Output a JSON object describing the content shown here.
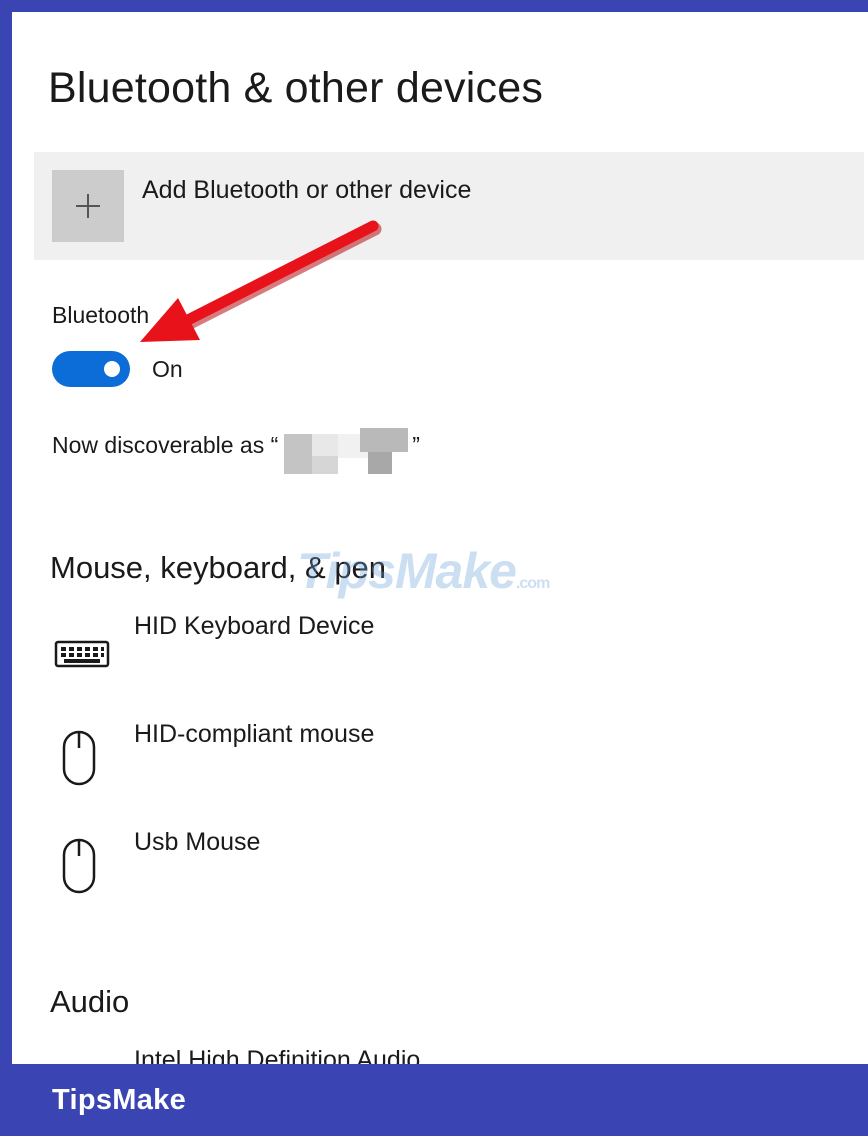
{
  "page": {
    "title": "Bluetooth & other devices"
  },
  "add_device": {
    "label": "Add Bluetooth or other device",
    "icon": "plus-icon"
  },
  "bluetooth": {
    "label": "Bluetooth",
    "toggle_on": true,
    "state_label": "On",
    "discoverable_prefix": "Now discoverable as “",
    "discoverable_suffix": "”"
  },
  "groups": {
    "input": {
      "heading": "Mouse, keyboard, & pen",
      "devices": [
        {
          "name": "HID Keyboard Device",
          "icon": "keyboard-icon"
        },
        {
          "name": "HID-compliant mouse",
          "icon": "mouse-icon"
        },
        {
          "name": "Usb Mouse",
          "icon": "mouse-icon"
        }
      ]
    },
    "audio": {
      "heading": "Audio",
      "devices": [
        {
          "name": "Intel High Definition Audio",
          "icon": "speaker-icon"
        }
      ]
    }
  },
  "watermark": {
    "text": "TipsMake",
    "suffix": ".com"
  },
  "footer": {
    "brand": "TipsMake"
  },
  "colors": {
    "frame": "#3a44b3",
    "toggle_accent": "#0d6dd8",
    "annotation_arrow": "#e8121a",
    "add_tile": "#cccccc",
    "add_row_bg": "#f0f0f0"
  }
}
